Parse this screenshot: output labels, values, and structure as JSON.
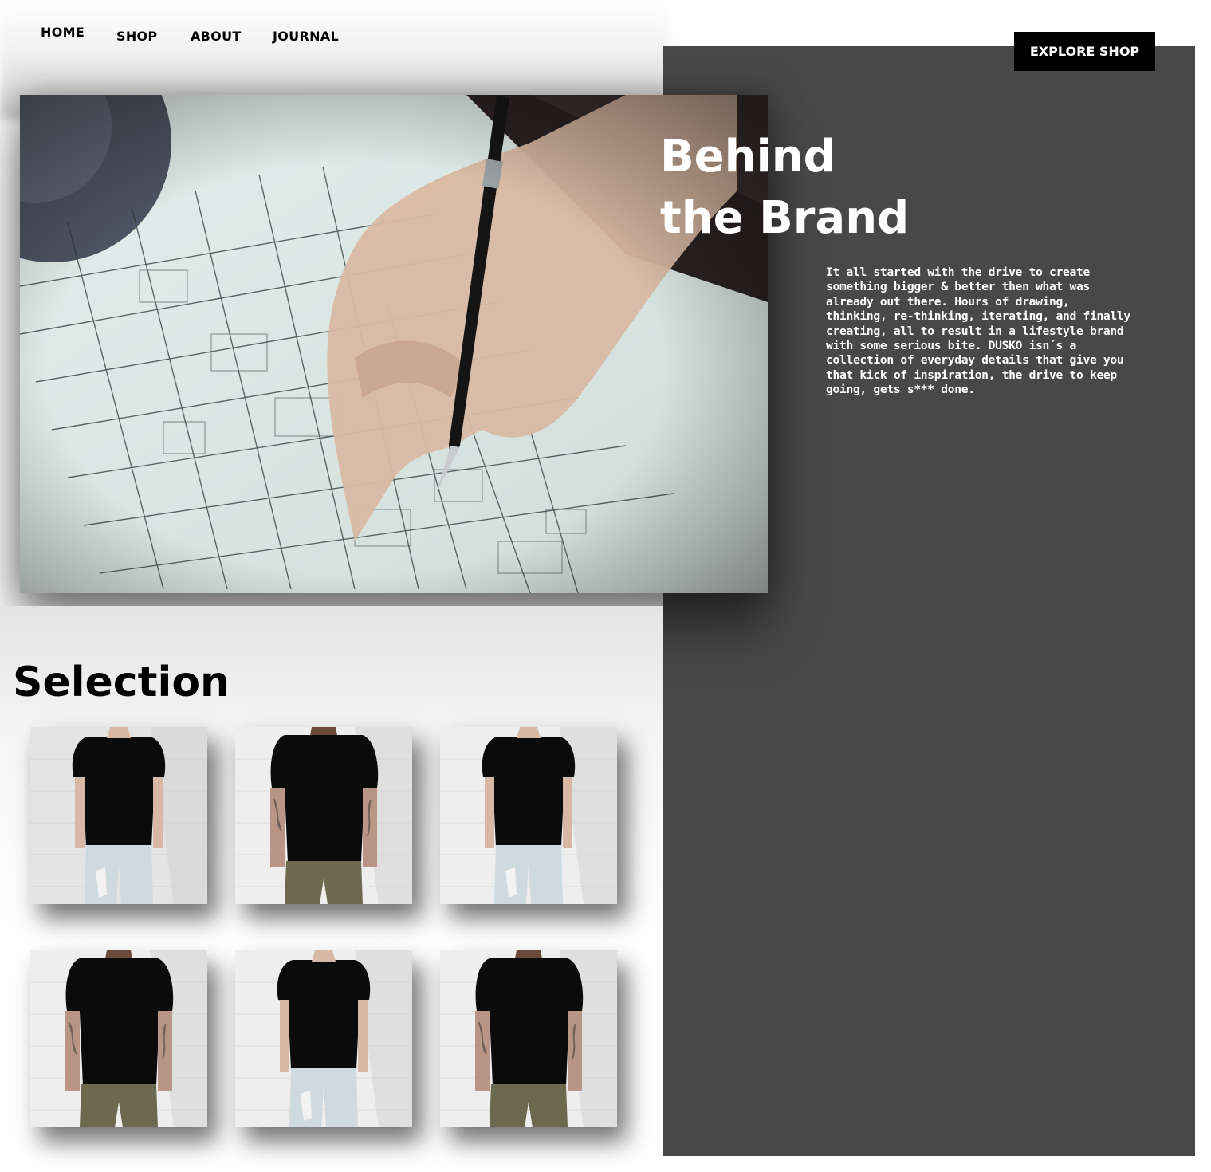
{
  "nav": {
    "items": [
      {
        "label": "HOME"
      },
      {
        "label": "SHOP"
      },
      {
        "label": "ABOUT"
      },
      {
        "label": "JOURNAL"
      }
    ]
  },
  "header": {
    "cta_label": "EXPLORE SHOP"
  },
  "hero": {
    "image": "architect-drawing-blueprint-photo",
    "title_line1": "Behind",
    "title_line2": "the Brand",
    "body": "It all started with the drive to create something bigger & better then what was already out there. Hours of drawing, thinking, re-thinking, iterating, and finally creating, all to result in a lifestyle brand with some serious bite. DUSKO isn´s a collection of everyday details that give you that kick of inspiration, the drive to keep going, gets s*** done."
  },
  "selection": {
    "title": "Selection",
    "products": [
      {
        "image": "woman-black-tshirt-ripped-jeans"
      },
      {
        "image": "man-black-tshirt-olive-pants"
      },
      {
        "image": "woman-black-tshirt-ripped-jeans"
      },
      {
        "image": "man-black-tshirt-olive-pants"
      },
      {
        "image": "woman-black-tshirt-ripped-jeans"
      },
      {
        "image": "man-black-tshirt-olive-pants"
      }
    ]
  },
  "colors": {
    "panel": "#484848",
    "button_bg": "#000000",
    "text_light": "#ffffff"
  }
}
